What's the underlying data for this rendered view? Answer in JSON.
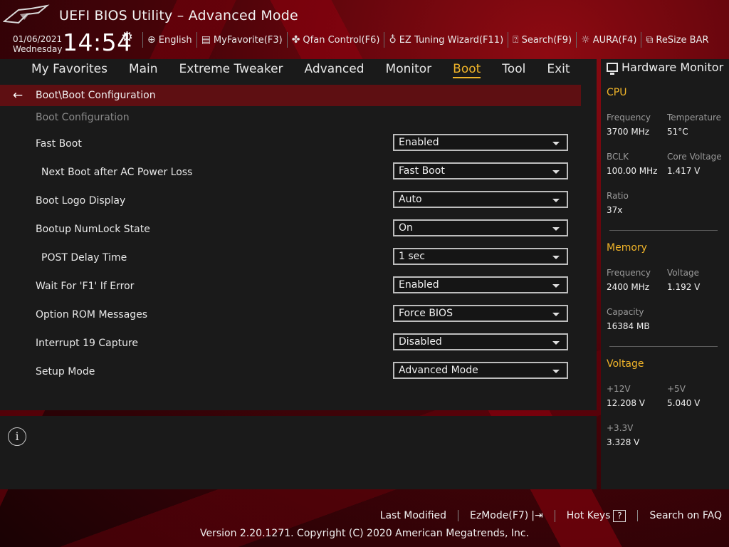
{
  "header": {
    "title": "UEFI BIOS Utility – Advanced Mode",
    "date": "01/06/2021",
    "day": "Wednesday",
    "time": "14:54"
  },
  "toolbar": [
    {
      "icon": "globe-icon",
      "label": "English"
    },
    {
      "icon": "myfavorite-icon",
      "label": "MyFavorite(F3)"
    },
    {
      "icon": "fan-icon",
      "label": "Qfan Control(F6)"
    },
    {
      "icon": "lightbulb-icon",
      "label": "EZ Tuning Wizard(F11)"
    },
    {
      "icon": "help-search-icon",
      "label": "Search(F9)"
    },
    {
      "icon": "aura-icon",
      "label": "AURA(F4)"
    },
    {
      "icon": "resize-bar-icon",
      "label": "ReSize BAR"
    }
  ],
  "tabs": [
    {
      "label": "My Favorites",
      "active": false
    },
    {
      "label": "Main",
      "active": false
    },
    {
      "label": "Extreme Tweaker",
      "active": false
    },
    {
      "label": "Advanced",
      "active": false
    },
    {
      "label": "Monitor",
      "active": false
    },
    {
      "label": "Boot",
      "active": true
    },
    {
      "label": "Tool",
      "active": false
    },
    {
      "label": "Exit",
      "active": false
    }
  ],
  "breadcrumb": "Boot\\Boot Configuration",
  "section_label": "Boot Configuration",
  "settings": [
    {
      "label": "Fast Boot",
      "value": "Enabled",
      "indent": false
    },
    {
      "label": "Next Boot after AC Power Loss",
      "value": "Fast Boot",
      "indent": true
    },
    {
      "label": "Boot Logo Display",
      "value": "Auto",
      "indent": false
    },
    {
      "label": "Bootup NumLock State",
      "value": "On",
      "indent": false
    },
    {
      "label": "POST Delay Time",
      "value": "1 sec",
      "indent": true
    },
    {
      "label": "Wait For 'F1' If Error",
      "value": "Enabled",
      "indent": false
    },
    {
      "label": "Option ROM Messages",
      "value": "Force BIOS",
      "indent": false
    },
    {
      "label": "Interrupt 19 Capture",
      "value": "Disabled",
      "indent": false
    },
    {
      "label": "Setup Mode",
      "value": "Advanced Mode",
      "indent": false
    }
  ],
  "hardware_monitor": {
    "title": "Hardware Monitor",
    "cpu": {
      "heading": "CPU",
      "frequency_label": "Frequency",
      "frequency": "3700 MHz",
      "temperature_label": "Temperature",
      "temperature": "51°C",
      "bclk_label": "BCLK",
      "bclk": "100.00 MHz",
      "core_voltage_label": "Core Voltage",
      "core_voltage": "1.417 V",
      "ratio_label": "Ratio",
      "ratio": "37x"
    },
    "memory": {
      "heading": "Memory",
      "frequency_label": "Frequency",
      "frequency": "2400 MHz",
      "voltage_label": "Voltage",
      "voltage": "1.192 V",
      "capacity_label": "Capacity",
      "capacity": "16384 MB"
    },
    "voltage": {
      "heading": "Voltage",
      "v12_label": "+12V",
      "v12": "12.208 V",
      "v5_label": "+5V",
      "v5": "5.040 V",
      "v33_label": "+3.3V",
      "v33": "3.328 V"
    }
  },
  "footer": {
    "last_modified": "Last Modified",
    "ezmode": "EzMode(F7)",
    "hot_keys": "Hot Keys",
    "hot_keys_key": "?",
    "search_faq": "Search on FAQ",
    "version": "Version 2.20.1271. Copyright (C) 2020 American Megatrends, Inc."
  },
  "colors": {
    "accent": "#f0b429",
    "breadcrumb_bg": "#5e0f12",
    "panel_bg": "#1a1a1a"
  }
}
